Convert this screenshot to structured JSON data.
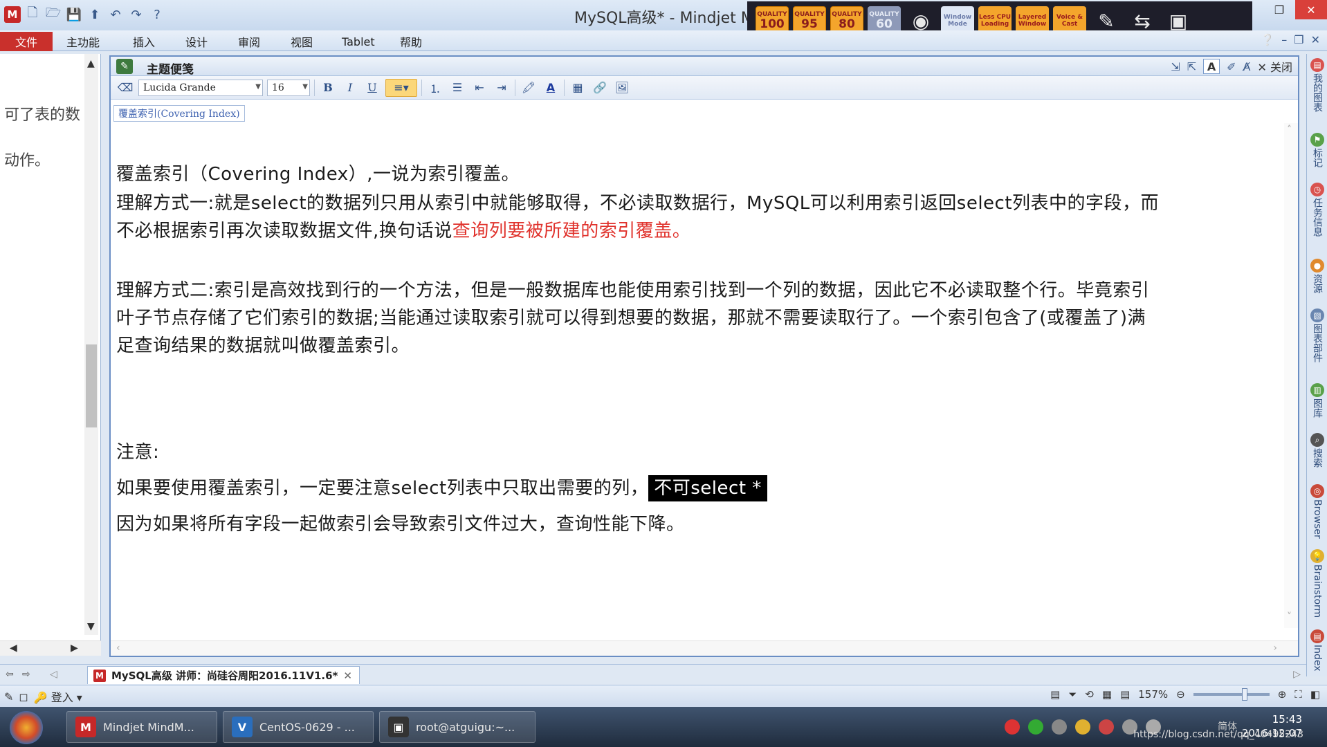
{
  "window": {
    "title": "MySQL高级* - Mindjet M",
    "app_logo": "M"
  },
  "ribbon": {
    "tabs": [
      "文件",
      "主功能",
      "插入",
      "设计",
      "审阅",
      "视图",
      "Tablet",
      "帮助"
    ]
  },
  "recorder": {
    "quality_buttons": [
      {
        "label": "QUALITY",
        "value": "100"
      },
      {
        "label": "QUALITY",
        "value": "95"
      },
      {
        "label": "QUALITY",
        "value": "80"
      },
      {
        "label": "QUALITY",
        "value": "60"
      }
    ],
    "mode_buttons": [
      "Window Mode",
      "Less CPU Loading",
      "Layered Window",
      "Voice & Cast"
    ]
  },
  "left_panel": {
    "lines": [
      "可了表的数",
      "动作。"
    ]
  },
  "notes": {
    "title": "主题便笺",
    "close_label": "关闭",
    "font_name": "Lucida Grande",
    "font_size": "16",
    "breadcrumb": "覆盖索引(Covering Index)",
    "para1": "覆盖索引（Covering Index）,一说为索引覆盖。",
    "para2_line1": "理解方式一:就是select的数据列只用从索引中就能够取得，不必读取数据行，MySQL可以利用索引返回select列表中的字段，而",
    "para2_line2_prefix": "不必根据索引再次读取数据文件,换句话说",
    "para2_line2_red": "查询列要被所建的索引覆盖。",
    "para3_line1": "理解方式二:索引是高效找到行的一个方法，但是一般数据库也能使用索引找到一个列的数据，因此它不必读取整个行。毕竟索引",
    "para3_line2": "叶子节点存储了它们索引的数据;当能通过读取索引就可以得到想要的数据，那就不需要读取行了。一个索引包含了(或覆盖了)满",
    "para3_line3": "足查询结果的数据就叫做覆盖索引。",
    "note_label": "注意:",
    "note_line1_prefix": "如果要使用覆盖索引，一定要注意select列表中只取出需要的列，",
    "note_line1_highlight": "不可select *",
    "note_line2": "因为如果将所有字段一起做索引会导致索引文件过大，查询性能下降。"
  },
  "right_sidebar": [
    "我的图表",
    "标记",
    "任务信息",
    "资源",
    "图表部件",
    "图库",
    "搜索",
    "Browser",
    "Brainstorm",
    "Index"
  ],
  "doc_tab": {
    "label": "MySQL高级 讲师：尚硅谷周阳2016.11V1.6*"
  },
  "status": {
    "login_label": "登入",
    "zoom": "157%"
  },
  "taskbar": {
    "items": [
      "Mindjet MindM...",
      "CentOS-0629 - ...",
      "root@atguigu:~..."
    ],
    "time": "15:43",
    "date": "2016-12-07",
    "watermark": "https://blog.csdn.net/qq_40495243",
    "ime": "简体"
  },
  "colors": {
    "accent_red": "#e0322c",
    "file_tab": "#c9302c",
    "notes_border": "#6a8ec4"
  }
}
